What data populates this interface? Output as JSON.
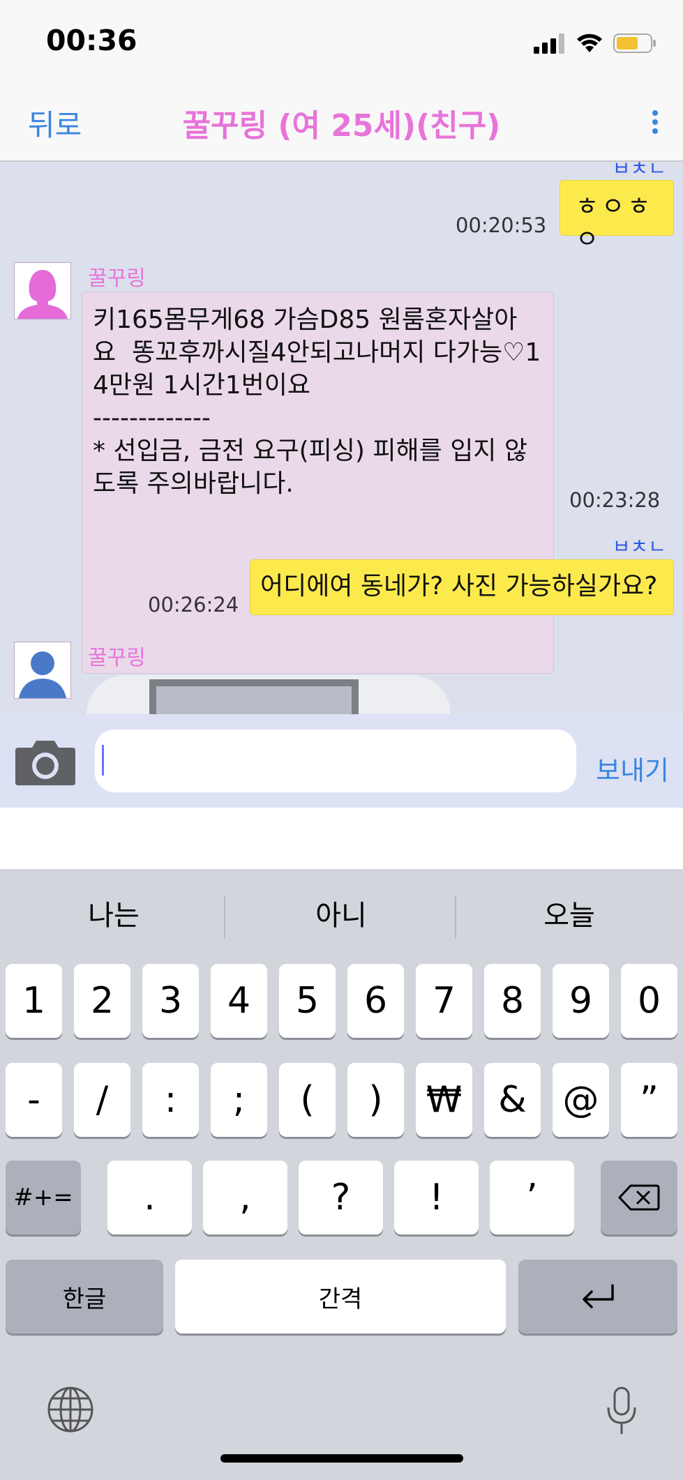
{
  "status_bar": {
    "time": "00:36"
  },
  "nav": {
    "back": "뒤로",
    "title": "꿀꾸링 (여 25세)(친구)"
  },
  "messages": [
    {
      "side": "right",
      "text": "ㅎㅇㅎㅇ",
      "time": "00:20:53",
      "read_mark": "ㅂㅊㄴ"
    },
    {
      "side": "left",
      "sender": "꿀꾸링",
      "lines": [
        "키165몸무게68 가슴D85 원룸혼자살아",
        "요  똥꼬후까시질4안되고나머지 다가능♡1",
        "4만원 1시간1번이요",
        "-------------",
        "* 선입금, 금전 요구(피싱) 피해를 입지 않",
        "도록 주의바랍니다."
      ],
      "time": "00:23:28"
    },
    {
      "side": "right",
      "text": "어디에여 동네가? 사진 가능하실가요?",
      "time": "00:26:24",
      "read_mark": "ㅂㅊㄴ"
    },
    {
      "side": "left",
      "sender": "꿀꾸링",
      "attachment": "photo"
    }
  ],
  "input": {
    "placeholder": "",
    "send": "보내기"
  },
  "keyboard": {
    "suggestions": [
      "나는",
      "아니",
      "오늘"
    ],
    "row1": [
      "1",
      "2",
      "3",
      "4",
      "5",
      "6",
      "7",
      "8",
      "9",
      "0"
    ],
    "row2": [
      "-",
      "/",
      ":",
      ";",
      "(",
      ")",
      "₩",
      "&",
      "@",
      "”"
    ],
    "row3": [
      "#+=",
      ".",
      ",",
      "?",
      "!",
      "’"
    ],
    "mode_key": "한글",
    "space_key": "간격"
  },
  "colors": {
    "accent": "#3a86e0",
    "title_pink": "#e774d9",
    "my_bubble": "#fcea4d",
    "their_bubble": "#ead9e9"
  },
  "icons": [
    "signal-icon",
    "wifi-icon",
    "battery-icon",
    "more-vert-icon",
    "camera-icon",
    "avatar-female-icon",
    "avatar-male-icon",
    "backspace-icon",
    "return-icon",
    "globe-icon",
    "microphone-icon"
  ]
}
